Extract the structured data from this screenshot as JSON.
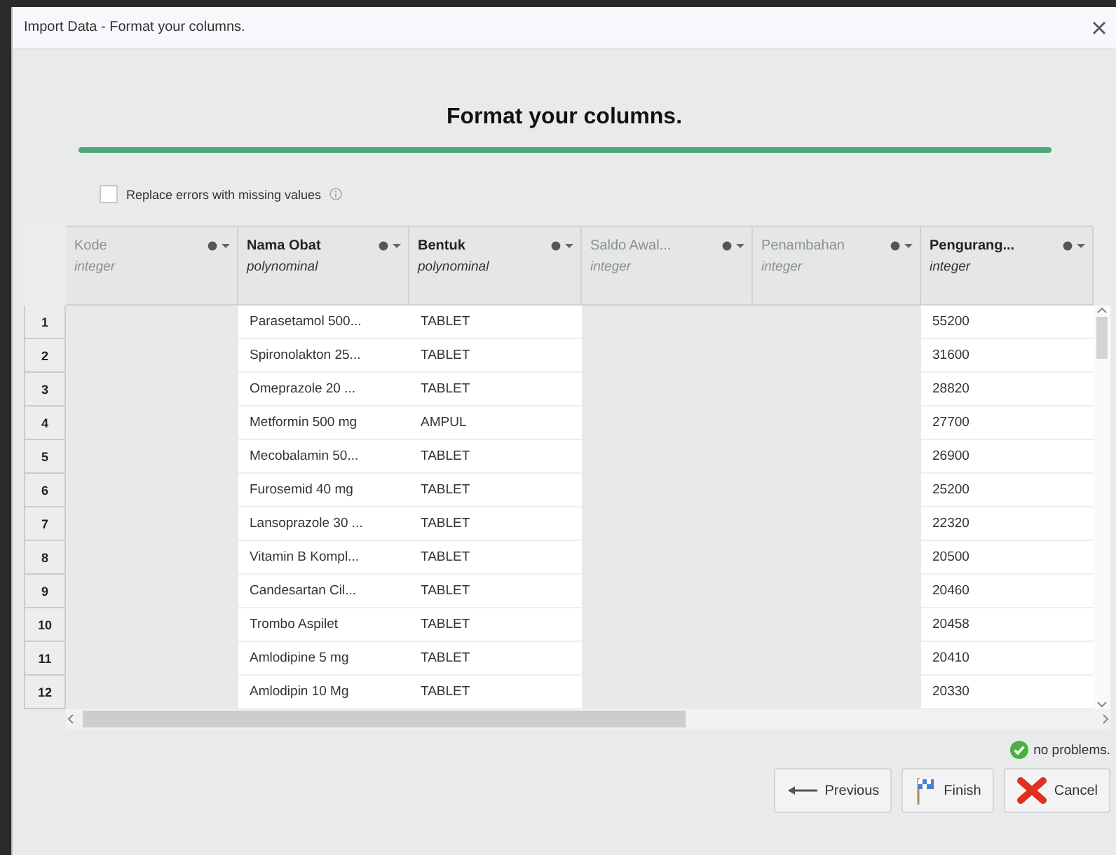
{
  "window": {
    "title": "Import Data - Format your columns."
  },
  "heading": "Format your columns.",
  "replace_errors": {
    "label": "Replace errors with missing values",
    "checked": false
  },
  "table": {
    "columns": [
      {
        "name": "Kode",
        "type": "integer",
        "disabled": true
      },
      {
        "name": "Nama Obat",
        "type": "polynominal",
        "disabled": false
      },
      {
        "name": "Bentuk",
        "type": "polynominal",
        "disabled": false
      },
      {
        "name": "Saldo Awal...",
        "type": "integer",
        "disabled": true
      },
      {
        "name": "Penambahan",
        "type": "integer",
        "disabled": true
      },
      {
        "name": "Pengurang...",
        "type": "integer",
        "disabled": false
      }
    ],
    "rows": [
      {
        "number": "1",
        "cells": [
          "",
          "Parasetamol 500...",
          "TABLET",
          "",
          "",
          "55200"
        ]
      },
      {
        "number": "2",
        "cells": [
          "",
          "Spironolakton 25...",
          "TABLET",
          "",
          "",
          "31600"
        ]
      },
      {
        "number": "3",
        "cells": [
          "",
          "Omeprazole 20 ...",
          "TABLET",
          "",
          "",
          "28820"
        ]
      },
      {
        "number": "4",
        "cells": [
          "",
          "Metformin 500 mg",
          "AMPUL",
          "",
          "",
          "27700"
        ]
      },
      {
        "number": "5",
        "cells": [
          "",
          "Mecobalamin 50...",
          "TABLET",
          "",
          "",
          "26900"
        ]
      },
      {
        "number": "6",
        "cells": [
          "",
          "Furosemid 40 mg",
          "TABLET",
          "",
          "",
          "25200"
        ]
      },
      {
        "number": "7",
        "cells": [
          "",
          "Lansoprazole 30 ...",
          "TABLET",
          "",
          "",
          "22320"
        ]
      },
      {
        "number": "8",
        "cells": [
          "",
          "Vitamin B Kompl...",
          "TABLET",
          "",
          "",
          "20500"
        ]
      },
      {
        "number": "9",
        "cells": [
          "",
          "Candesartan Cil...",
          "TABLET",
          "",
          "",
          "20460"
        ]
      },
      {
        "number": "10",
        "cells": [
          "",
          "Trombo Aspilet",
          "TABLET",
          "",
          "",
          "20458"
        ]
      },
      {
        "number": "11",
        "cells": [
          "",
          "Amlodipine 5 mg",
          "TABLET",
          "",
          "",
          "20410"
        ]
      },
      {
        "number": "12",
        "cells": [
          "",
          "Amlodipin 10 Mg",
          "TABLET",
          "",
          "",
          "20330"
        ]
      }
    ]
  },
  "status": "no problems.",
  "buttons": [
    {
      "label": "Previous",
      "kind": "previous"
    },
    {
      "label": "Finish",
      "kind": "finish"
    },
    {
      "label": "Cancel",
      "kind": "cancel"
    }
  ]
}
